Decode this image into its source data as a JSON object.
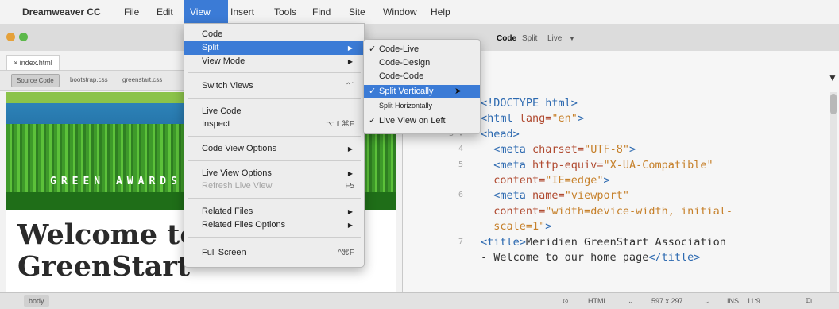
{
  "menubar": {
    "app_name": "Dreamweaver CC",
    "items": [
      "File",
      "Edit",
      "View",
      "Insert",
      "Tools",
      "Find",
      "Site",
      "Window",
      "Help"
    ]
  },
  "toolbar": {
    "view_modes": [
      "Code",
      "Split",
      "Live"
    ]
  },
  "document": {
    "tab_name": "index.html",
    "related_files": [
      "Source Code",
      "bootstrap.css",
      "greenstart.css"
    ]
  },
  "live_view": {
    "banner": "GREEN AWARDS",
    "heading_line1": "Welcome to",
    "heading_line2": "GreenStart"
  },
  "view_menu": {
    "code": "Code",
    "split": "Split",
    "view_mode": "View Mode",
    "switch_views": "Switch Views",
    "switch_views_shortcut": "⌃`",
    "live_code": "Live Code",
    "inspect": "Inspect",
    "inspect_shortcut": "⌥⇧⌘F",
    "code_view_options": "Code View Options",
    "live_view_options": "Live View Options",
    "refresh_live_view": "Refresh Live View",
    "refresh_shortcut": "F5",
    "related_files": "Related Files",
    "related_files_options": "Related Files Options",
    "full_screen": "Full Screen",
    "full_screen_shortcut": "^⌘F"
  },
  "split_submenu": {
    "code_live": "Code-Live",
    "code_design": "Code-Design",
    "code_code": "Code-Code",
    "split_vertically": "Split Vertically",
    "split_horizontally": "Split Horizontally",
    "live_view_on_left": "Live View on Left"
  },
  "code": {
    "lines": [
      {
        "n": "",
        "parts": [
          [
            "tag",
            "<!DOCTYPE html>"
          ]
        ]
      },
      {
        "n": "2",
        "parts": [
          [
            "tag",
            "<html"
          ],
          [
            "attr",
            " lang="
          ],
          [
            "str",
            "\"en\""
          ],
          [
            "tag",
            ">"
          ]
        ]
      },
      {
        "n": "3 ▼",
        "parts": [
          [
            "tag",
            "<head>"
          ]
        ]
      },
      {
        "n": "4",
        "parts": [
          [
            "plain",
            "  "
          ],
          [
            "tag",
            "<meta"
          ],
          [
            "attr",
            " charset="
          ],
          [
            "str",
            "\"UTF-8\""
          ],
          [
            "tag",
            ">"
          ]
        ]
      },
      {
        "n": "5",
        "parts": [
          [
            "plain",
            "  "
          ],
          [
            "tag",
            "<meta"
          ],
          [
            "attr",
            " http-equiv="
          ],
          [
            "str",
            "\"X-UA-Compatible\""
          ]
        ]
      },
      {
        "n": "",
        "parts": [
          [
            "plain",
            "  "
          ],
          [
            "attr",
            "content="
          ],
          [
            "str",
            "\"IE=edge\""
          ],
          [
            "tag",
            ">"
          ]
        ]
      },
      {
        "n": "6",
        "parts": [
          [
            "plain",
            "  "
          ],
          [
            "tag",
            "<meta"
          ],
          [
            "attr",
            " name="
          ],
          [
            "str",
            "\"viewport\""
          ]
        ]
      },
      {
        "n": "",
        "parts": [
          [
            "plain",
            "  "
          ],
          [
            "attr",
            "content="
          ],
          [
            "str",
            "\"width=device-width, initial-"
          ]
        ]
      },
      {
        "n": "",
        "parts": [
          [
            "plain",
            "  "
          ],
          [
            "str",
            "scale=1\""
          ],
          [
            "tag",
            ">"
          ]
        ]
      },
      {
        "n": "7",
        "parts": [
          [
            "tag",
            "<title>"
          ],
          [
            "plain",
            "Meridien GreenStart Association"
          ]
        ]
      },
      {
        "n": "",
        "parts": [
          [
            "plain",
            "- Welcome to our home page"
          ],
          [
            "tag",
            "</title>"
          ]
        ]
      }
    ]
  },
  "statusbar": {
    "left_tag": "body",
    "doc_type": "HTML",
    "dimensions": "597 x 297",
    "insert_mode": "INS",
    "position": "11:9"
  },
  "colors": {
    "menu_highlight": "#3b7bd6",
    "code_tag": "#2c69b0",
    "code_attr": "#b04a30",
    "code_string": "#c6802a"
  }
}
